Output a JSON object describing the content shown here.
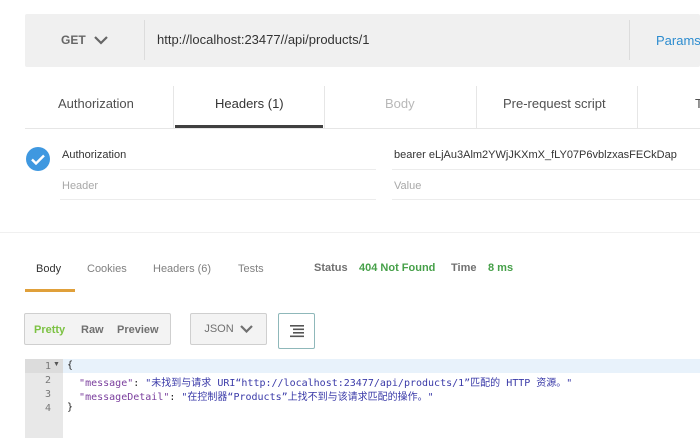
{
  "request": {
    "method": "GET",
    "url": "http://localhost:23477//api/products/1",
    "params_label": "Params"
  },
  "request_tabs": [
    {
      "label": "Authorization",
      "active": false
    },
    {
      "label": "Headers (1)",
      "active": true
    },
    {
      "label": "Body",
      "active": false,
      "disabled": true
    },
    {
      "label": "Pre-request script",
      "active": false
    },
    {
      "label": "T",
      "active": false
    }
  ],
  "headers_table": {
    "rows": [
      {
        "key": "Authorization",
        "value": "bearer eLjAu3Alm2YWjJKXmX_fLY07P6vblzxasFECkDap",
        "enabled": true
      }
    ],
    "key_placeholder": "Header",
    "value_placeholder": "Value"
  },
  "response_tabs": [
    {
      "label": "Body",
      "active": true
    },
    {
      "label": "Cookies",
      "active": false
    },
    {
      "label": "Headers (6)",
      "active": false
    },
    {
      "label": "Tests",
      "active": false
    }
  ],
  "response_status": {
    "status_label": "Status",
    "status_value": "404 Not Found",
    "time_label": "Time",
    "time_value": "8 ms"
  },
  "format_buttons": {
    "pretty": "Pretty",
    "raw": "Raw",
    "preview": "Preview",
    "format_select": "JSON"
  },
  "code": {
    "line_numbers": [
      "1",
      "2",
      "3",
      "4"
    ],
    "line1": "{",
    "message_key": "\"message\"",
    "message_value": "\"未找到与请求 URI“http://localhost:23477/api/products/1”匹配的 HTTP 资源。\"",
    "detail_key": "\"messageDetail\"",
    "detail_value": "\"在控制器“Products”上找不到与该请求匹配的操作。\"",
    "line4": "}"
  },
  "colors": {
    "accent_blue": "#3f98e0",
    "status_green": "#46a049",
    "active_tab_orange": "#e0a03a",
    "params_blue": "#2d8ccf"
  }
}
